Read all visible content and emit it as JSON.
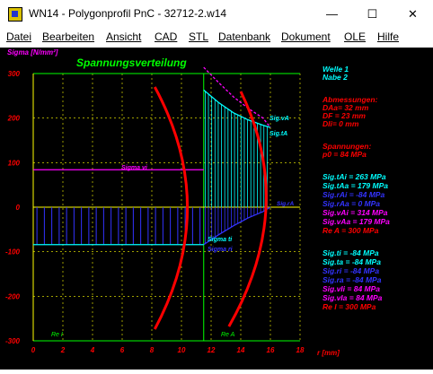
{
  "window": {
    "title": "WN14  -  Polygonprofil PnC  -  32712-2.w14",
    "minimize": "—",
    "maximize": "☐",
    "close": "✕"
  },
  "menu": [
    "Datei",
    "Bearbeiten",
    "Ansicht",
    "CAD",
    "STL",
    "Datenbank",
    "Dokument",
    "OLE",
    "Hilfe"
  ],
  "chart_data": {
    "type": "line",
    "title": "Spannungsverteilung",
    "ylabel": "Sigma [N/mm²]",
    "xlabel": "r [mm]",
    "xlim": [
      0,
      18
    ],
    "ylim": [
      -300,
      300
    ],
    "x_ticks": [
      0,
      2,
      4,
      6,
      8,
      10,
      12,
      14,
      16,
      18
    ],
    "y_ticks": [
      300,
      200,
      100,
      0,
      -100,
      -200,
      -300
    ],
    "grid": true,
    "series": [
      {
        "name": "Sig.tA",
        "x": [
          11.5,
          12.5,
          13.5,
          14.5,
          15.5,
          16
        ],
        "y": [
          263,
          235,
          212,
          196,
          184,
          179
        ]
      },
      {
        "name": "Sig.vA",
        "x": [
          11.5,
          12.5,
          13.5,
          14.5,
          15.5,
          16
        ],
        "y": [
          314,
          280,
          248,
          222,
          200,
          179
        ]
      },
      {
        "name": "Sig.rA",
        "x": [
          11.5,
          12.5,
          13.5,
          14.5,
          15.5,
          16
        ],
        "y": [
          -84,
          -62,
          -42,
          -24,
          -10,
          0
        ]
      },
      {
        "name": "Sigma vi",
        "x": [
          0,
          11.5
        ],
        "y": [
          84,
          84
        ]
      },
      {
        "name": "Sigma ti",
        "x": [
          0,
          11.5
        ],
        "y": [
          -84,
          -84
        ]
      }
    ],
    "annotations": [
      "Sig.vA",
      "Sig.tA",
      "Sigma vi",
      "Sig.rA",
      "Sigma ti",
      "Sigma ri",
      "Re I",
      "Re A"
    ],
    "colors": {
      "background": "#000000",
      "axis": "#ffff00",
      "tick_labels": "#ff0000",
      "title": "#00ff00",
      "tA": "#00ffff",
      "vA": "#ff00ff",
      "rA": "#0000ff",
      "grid": "#ffff00",
      "profile": "#ff0000"
    }
  },
  "info": {
    "welle": "Welle  1",
    "nabe": "Nabe  2",
    "dims_header": "Abmessungen:",
    "daa": "DAa= 32 mm",
    "df": "DF = 23 mm",
    "dii": "DIi= 0 mm",
    "stress_header": "Spannungen:",
    "p0": "p0 =   84 MPa",
    "sigtai": "Sig.tAi =  263 MPa",
    "sigtaa": "Sig.tAa =  179 MPa",
    "sigrai": "Sig.rAi =  -84 MPa",
    "sigraa": "Sig.rAa =     0 MPa",
    "sigvai": "Sig.vAi = 314 MPa",
    "sigvaa": "Sig.vAa =  179 MPa",
    "rea": "Re A =  300 MPa",
    "sigti": "Sig.ti = -84 MPa",
    "sigta": "Sig.ta = -84 MPa",
    "sigri": "Sig.ri = -84 MPa",
    "sigra": "Sig.ra = -84 MPa",
    "sigvii": "Sig.vIi =  84 MPa",
    "sigvia": "Sig.vIa =  84 MPa",
    "rei": "Re I =  300 MPa"
  }
}
